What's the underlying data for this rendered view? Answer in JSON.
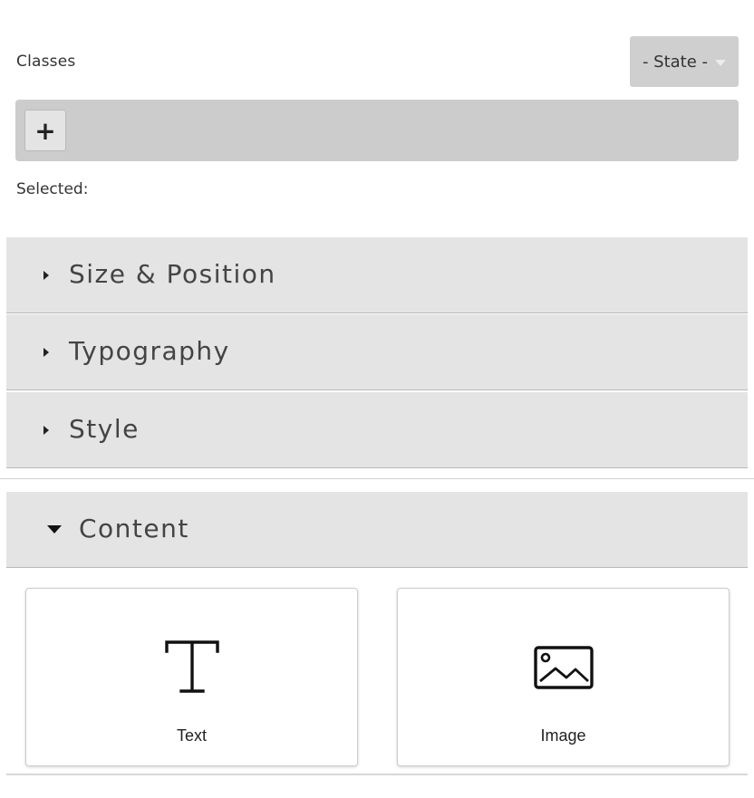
{
  "classes": {
    "label": "Classes",
    "state_select": {
      "value": "- State -"
    },
    "add_button_label": "+",
    "selected_label": "Selected:"
  },
  "sectors": [
    {
      "title": "Size & Position",
      "expanded": false
    },
    {
      "title": "Typography",
      "expanded": false
    },
    {
      "title": "Style",
      "expanded": false
    },
    {
      "title": "Content",
      "expanded": true
    }
  ],
  "blocks": [
    {
      "label": "Text",
      "icon": "text-t-icon"
    },
    {
      "label": "Image",
      "icon": "image-icon"
    }
  ]
}
